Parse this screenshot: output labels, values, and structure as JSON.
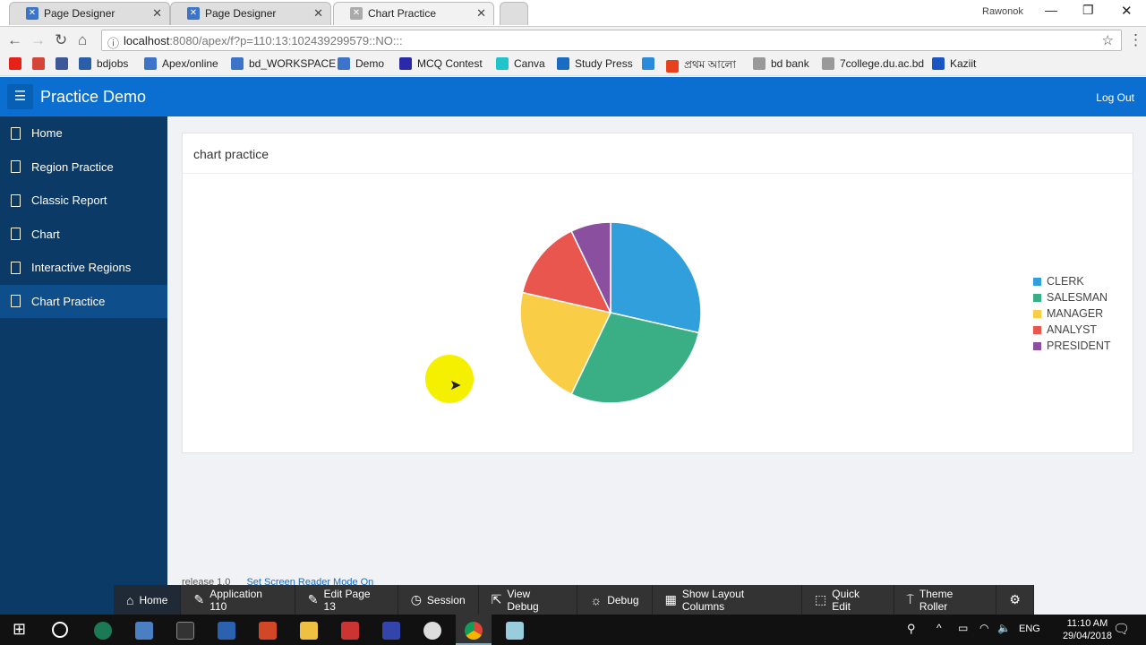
{
  "browser": {
    "tabs": [
      {
        "label": "Page Designer"
      },
      {
        "label": "Page Designer"
      },
      {
        "label": "Chart Practice",
        "active": true
      }
    ],
    "profile": "Rawonok",
    "url_host": "localhost",
    "url_rest": ":8080/apex/f?p=110:13:102439299579::NO:::",
    "bookmarks": [
      {
        "label": "",
        "icon": "youtube-icon",
        "color": "#e62117"
      },
      {
        "label": "",
        "icon": "gmail-icon",
        "color": "#d44638"
      },
      {
        "label": "",
        "icon": "facebook-icon",
        "color": "#3b5998"
      },
      {
        "label": "bdjobs",
        "icon": "bdjobs-icon",
        "color": "#2a5fa8"
      },
      {
        "label": "Apex/online",
        "icon": "apex-icon",
        "color": "#3b74c8"
      },
      {
        "label": "bd_WORKSPACE",
        "icon": "apex-icon",
        "color": "#3b74c8"
      },
      {
        "label": "Demo",
        "icon": "apex-icon",
        "color": "#3b74c8"
      },
      {
        "label": "MCQ Contest",
        "icon": "check-icon",
        "color": "#2a2aa8"
      },
      {
        "label": "Canva",
        "icon": "canva-icon",
        "color": "#20c4cb"
      },
      {
        "label": "Study Press",
        "icon": "studypress-icon",
        "color": "#1a6cc2"
      },
      {
        "label": "",
        "icon": "owl-icon",
        "color": "#2a8adb"
      },
      {
        "label": "প্রথম আলো",
        "icon": "sun-icon",
        "color": "#e8401c"
      },
      {
        "label": "bd bank",
        "icon": "page-icon",
        "color": "#999"
      },
      {
        "label": "7college.du.ac.bd",
        "icon": "page-icon",
        "color": "#999"
      },
      {
        "label": "Kaziit",
        "icon": "k-icon",
        "color": "#1a56c2"
      }
    ]
  },
  "app": {
    "title": "Practice Demo",
    "logout": "Log Out",
    "accent": "#0a6fd1"
  },
  "sidebar": {
    "items": [
      {
        "label": "Home"
      },
      {
        "label": "Region Practice"
      },
      {
        "label": "Classic Report"
      },
      {
        "label": "Chart"
      },
      {
        "label": "Interactive Regions"
      },
      {
        "label": "Chart Practice",
        "active": true
      }
    ]
  },
  "region": {
    "title": "chart practice"
  },
  "chart_data": {
    "type": "pie",
    "categories": [
      "CLERK",
      "SALESMAN",
      "MANAGER",
      "ANALYST",
      "PRESIDENT"
    ],
    "values": [
      4,
      4,
      3,
      2,
      1
    ],
    "colors": [
      "#309fdb",
      "#3aaf85",
      "#f9cd46",
      "#e9564e",
      "#8a4f9e"
    ],
    "legend": "right"
  },
  "footer": {
    "release": "release 1.0",
    "screen_reader": "Set Screen Reader Mode On"
  },
  "devbar": {
    "items": [
      {
        "label": "Home",
        "icon": "home-icon",
        "glyph": "⌂"
      },
      {
        "label": "Application 110",
        "icon": "edit-icon",
        "glyph": "✎"
      },
      {
        "label": "Edit Page 13",
        "icon": "edit-page-icon",
        "glyph": "✎"
      },
      {
        "label": "Session",
        "icon": "clock-icon",
        "glyph": "◷"
      },
      {
        "label": "View Debug",
        "icon": "view-debug-icon",
        "glyph": "⇱"
      },
      {
        "label": "Debug",
        "icon": "bug-icon",
        "glyph": "☼"
      },
      {
        "label": "Show Layout Columns",
        "icon": "grid-icon",
        "glyph": "▦"
      },
      {
        "label": "Quick Edit",
        "icon": "quick-edit-icon",
        "glyph": "⬚"
      },
      {
        "label": "Theme Roller",
        "icon": "paint-roller-icon",
        "glyph": "⍑"
      },
      {
        "label": "",
        "icon": "gear-icon",
        "glyph": "⚙"
      }
    ]
  },
  "taskbar": {
    "time": "11:10 AM",
    "date": "29/04/2018",
    "lang": "ENG"
  }
}
